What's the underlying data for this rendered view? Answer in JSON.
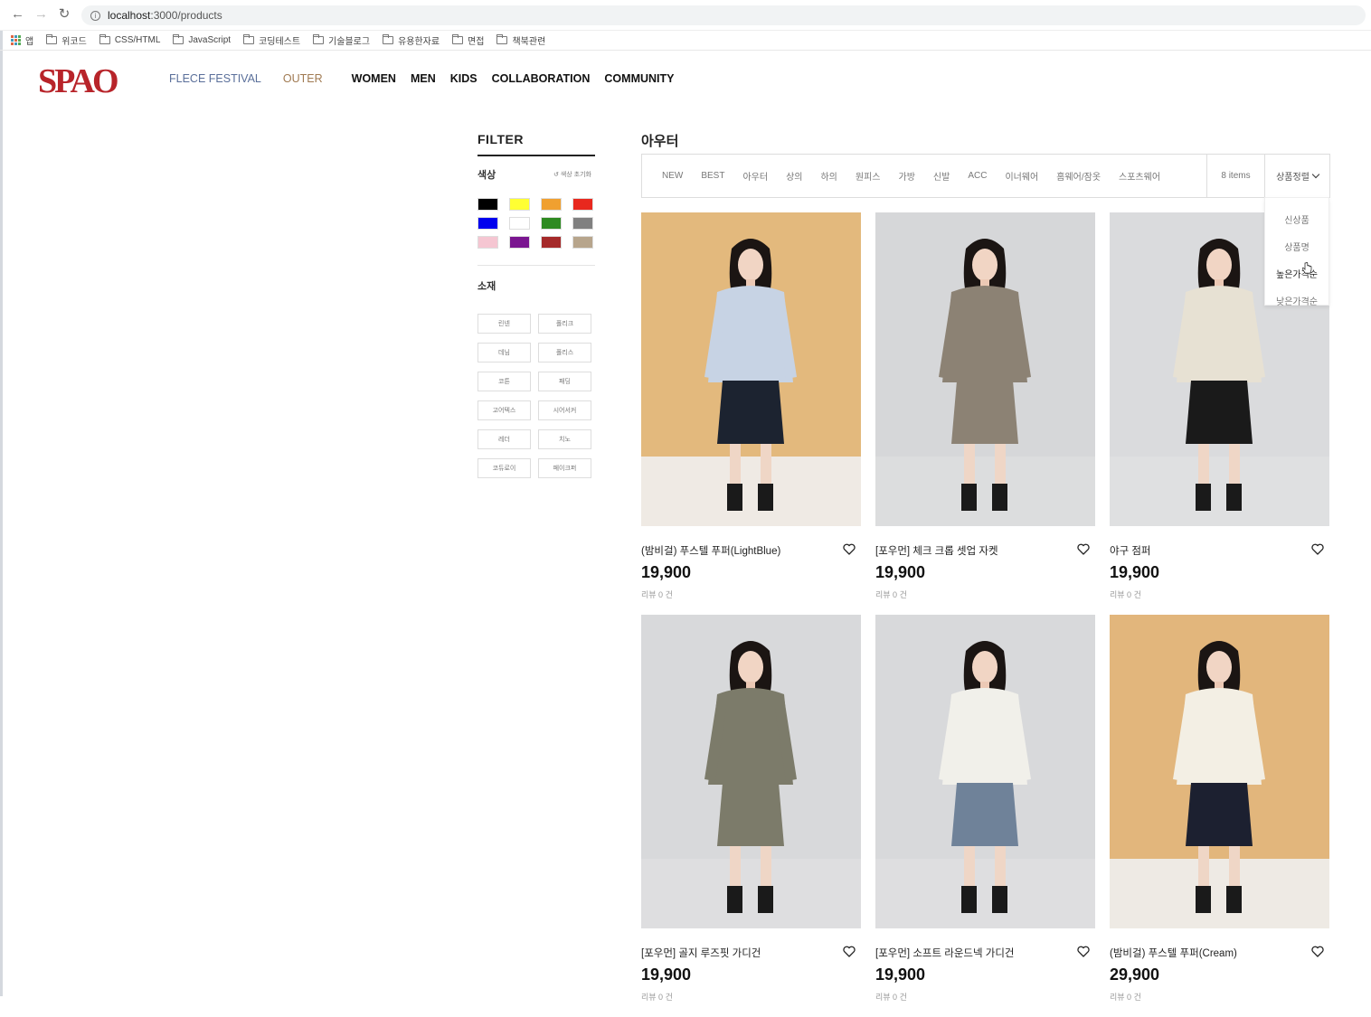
{
  "browser": {
    "url_host": "localhost",
    "url_path": ":3000/products",
    "bookmarks": [
      "앱",
      "위코드",
      "CSS/HTML",
      "JavaScript",
      "코딩테스트",
      "기술블로그",
      "유용한자료",
      "면접",
      "책북관련"
    ]
  },
  "site": {
    "logo": "SPAO",
    "nav": [
      "FLECE FESTIVAL",
      "OUTER",
      "WOMEN",
      "MEN",
      "KIDS",
      "COLLABORATION",
      "COMMUNITY"
    ]
  },
  "filter": {
    "title": "FILTER",
    "color_label": "색상",
    "reset_label": "색상 초기화",
    "colors": [
      "#000000",
      "#ffff33",
      "#f0a030",
      "#e8281e",
      "#0000ee",
      "#ffffff",
      "#2e8a22",
      "#808080",
      "#f5c6d2",
      "#7a1690",
      "#a52a2a",
      "#b7a58c"
    ],
    "material_label": "소재",
    "materials": [
      "린넨",
      "폴리크",
      "데님",
      "폴리스",
      "코튼",
      "패딩",
      "고어텍스",
      "시어서커",
      "레더",
      "치노",
      "코듀로이",
      "페이크퍼"
    ]
  },
  "main": {
    "category_title": "아우터",
    "tabs": [
      "NEW",
      "BEST",
      "아우터",
      "상의",
      "하의",
      "원피스",
      "가방",
      "신발",
      "ACC",
      "이너웨어",
      "홈웨어/잠옷",
      "스포츠웨어"
    ],
    "item_count": "8 items",
    "sort_label": "상품정렬",
    "sort_options": [
      "신상품",
      "상품명",
      "높은가격순",
      "낮은가격순"
    ]
  },
  "products": [
    {
      "name": "(밤비걸) 푸스텔 푸퍼(LightBlue)",
      "price": "19,900",
      "review": "리뷰 0 건",
      "bg": "#e3b97d",
      "top": "#c7d3e4",
      "bottom": "#1c2330"
    },
    {
      "name": "[포우먼] 체크 크롭 셋업 자켓",
      "price": "19,900",
      "review": "리뷰 0 건",
      "bg": "#d6d7d9",
      "top": "#8c8274",
      "bottom": "#8c8274"
    },
    {
      "name": "야구 점퍼",
      "price": "19,900",
      "review": "리뷰 0 건",
      "bg": "#dadbdd",
      "top": "#e7e1d3",
      "bottom": "#1a1a1a"
    },
    {
      "name": "[포우먼] 골지 루즈핏 가디건",
      "price": "19,900",
      "review": "리뷰 0 건",
      "bg": "#d8d9db",
      "top": "#7c7b6a",
      "bottom": "#7c7b6a"
    },
    {
      "name": "[포우먼] 소프트 라운드넥 가디건",
      "price": "19,900",
      "review": "리뷰 0 건",
      "bg": "#d8d9db",
      "top": "#f1f0ea",
      "bottom": "#6f8299"
    },
    {
      "name": "(밤비걸) 푸스텔 푸퍼(Cream)",
      "price": "29,900",
      "review": "리뷰 0 건",
      "bg": "#e2b67c",
      "top": "#f3efe4",
      "bottom": "#1c2030"
    }
  ]
}
